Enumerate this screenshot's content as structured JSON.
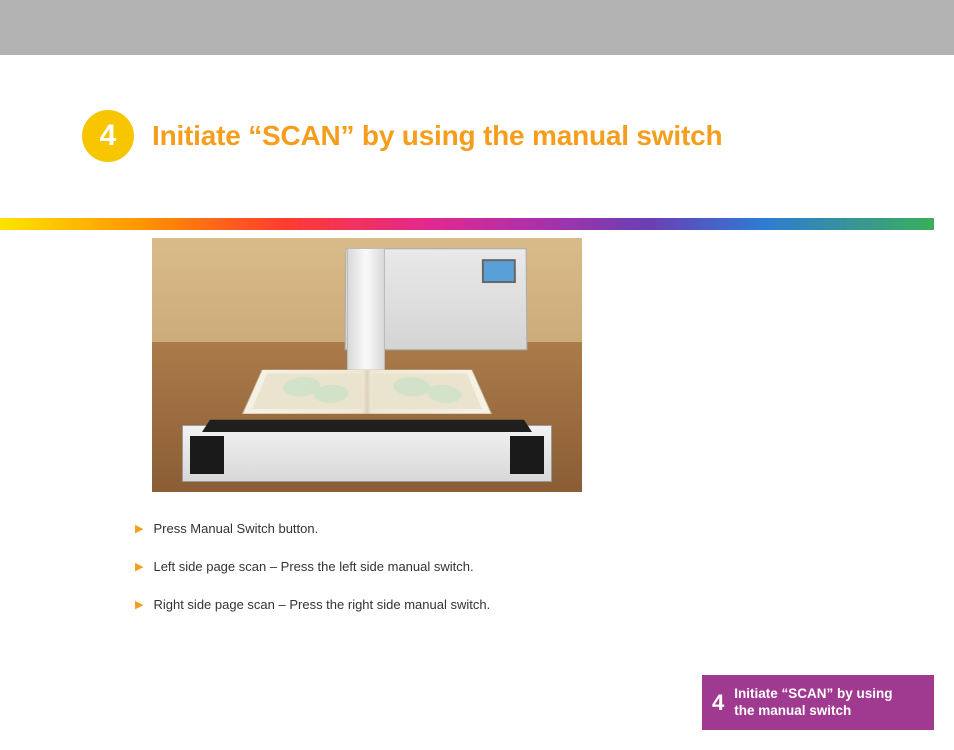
{
  "header": {
    "step_number": "4",
    "title": "Initiate “SCAN” by using the manual switch"
  },
  "steps": [
    "Press Manual Switch button.",
    "Left side page scan – Press the left side manual switch.",
    "Right side page scan – Press the right side manual switch."
  ],
  "tab": {
    "number": "4",
    "line1": "Initiate “SCAN” by using",
    "line2": "the manual switch"
  }
}
